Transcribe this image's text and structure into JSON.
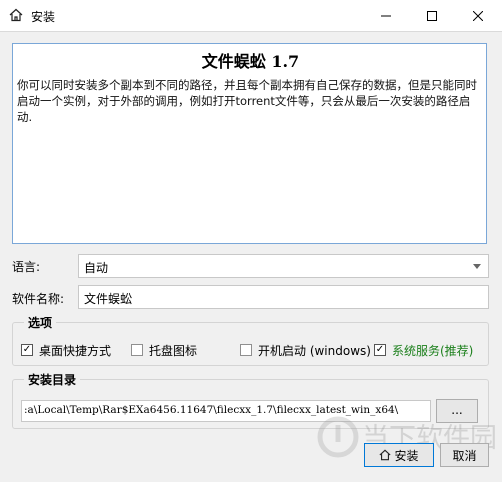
{
  "window": {
    "title": "安装",
    "icons": {
      "app": "home-icon",
      "minimize": "minimize-icon",
      "maximize": "maximize-icon",
      "close": "close-icon"
    }
  },
  "info": {
    "heading": "文件蜈蚣 1.7",
    "body": "你可以同时安装多个副本到不同的路径，并且每个副本拥有自己保存的数据，但是只能同时启动一个实例，对于外部的调用，例如打开torrent文件等，只会从最后一次安装的路径启动."
  },
  "language": {
    "label": "语言:",
    "selected": "自动"
  },
  "software_name": {
    "label": "软件名称:",
    "value": "文件蜈蚣"
  },
  "options": {
    "title": "选项",
    "items": [
      {
        "label": "桌面快捷方式",
        "checked": true
      },
      {
        "label": "托盘图标",
        "checked": false
      },
      {
        "label": "开机启动 (windows)",
        "checked": false
      },
      {
        "label": "系统服务(推荐)",
        "checked": true
      }
    ],
    "highlight_color": "#1a7f1a"
  },
  "install_dir": {
    "title": "安装目录",
    "path": ":a\\Local\\Temp\\Rar$EXa6456.11647\\filecxx_1.7\\filecxx_latest_win_x64\\",
    "browse_label": "..."
  },
  "buttons": {
    "install": "安装",
    "cancel": "取消"
  },
  "watermark": {
    "text": "当下软件园"
  }
}
